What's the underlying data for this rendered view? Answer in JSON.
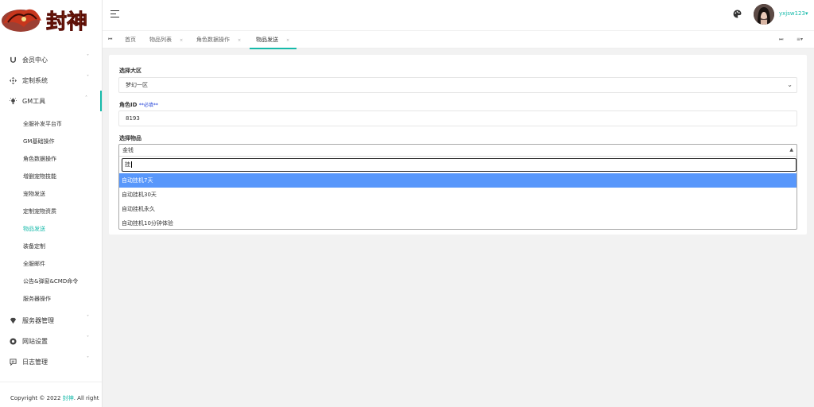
{
  "app": {
    "logo_text": "封神",
    "footer_prefix": "Copyright © 2022 ",
    "footer_brand": "封神",
    "footer_suffix": ". All right"
  },
  "sidebar": {
    "groups": [
      {
        "label": "会员中心",
        "icon": "magnet-icon",
        "arrow": "˅"
      },
      {
        "label": "定制系统",
        "icon": "move-icon",
        "arrow": "˅"
      },
      {
        "label": "GM工具",
        "icon": "bulb-icon",
        "arrow": "˄"
      },
      {
        "label": "服务器管理",
        "icon": "diamond-icon",
        "arrow": "˅"
      },
      {
        "label": "网站设置",
        "icon": "chrome-icon",
        "arrow": "˅"
      },
      {
        "label": "日志管理",
        "icon": "message-icon",
        "arrow": "˅"
      }
    ],
    "sub_items": [
      "全服补发平台币",
      "GM基础操作",
      "角色数据操作",
      "增删宠物技能",
      "宠物发送",
      "定制宠物资质",
      "物品发送",
      "装备定制",
      "全服邮件",
      "公告&弹窗&CMD命令",
      "服务器操作"
    ]
  },
  "header": {
    "username": "yxjsw123",
    "caret": "▾"
  },
  "tabs": {
    "home_icon": "⏮",
    "items": [
      {
        "label": "首页",
        "close": ""
      },
      {
        "label": "物品列表",
        "close": "×"
      },
      {
        "label": "角色数据操作",
        "close": "×"
      },
      {
        "label": "物品发送",
        "close": "×"
      }
    ],
    "next_icon": "⏭",
    "menu_icon": "≡▾"
  },
  "form": {
    "region_label": "选择大区",
    "region_value": "梦幻一区",
    "role_label": "角色ID",
    "role_required": "**必填**",
    "role_value": "8193",
    "item_label": "选择物品",
    "item_value": "金钱",
    "search_value": "挂",
    "options": [
      "自动挂机7天",
      "自动挂机30天",
      "自动挂机永久",
      "自动挂机10分钟体验"
    ]
  },
  "colors": {
    "accent": "#16baaa",
    "highlight": "#5897fb"
  }
}
